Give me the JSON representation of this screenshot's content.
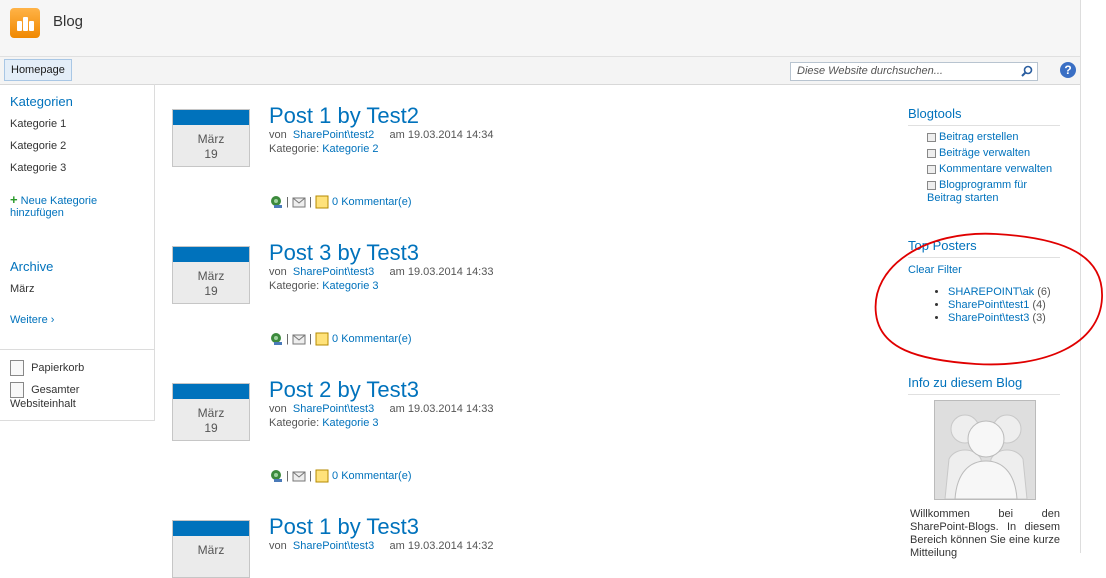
{
  "header": {
    "title": "Blog"
  },
  "topnav": {
    "home": "Homepage",
    "search_placeholder": "Diese Website durchsuchen..."
  },
  "left": {
    "categories_heading": "Kategorien",
    "categories": [
      "Kategorie 1",
      "Kategorie 2",
      "Kategorie 3"
    ],
    "new_category": "Neue Kategorie hinzufügen",
    "archive_heading": "Archive",
    "archive_items": [
      "März"
    ],
    "more": "Weitere ›",
    "recycle": "Papierkorb",
    "all_content": "Gesamter Websiteinhalt"
  },
  "posts": [
    {
      "month": "März",
      "day": "19",
      "title": "Post 1 by Test2",
      "von": "von",
      "author": "SharePoint\\test2",
      "am": "am 19.03.2014 14:34",
      "cat_label": "Kategorie:",
      "category": "Kategorie 2",
      "comments": "0 Kommentar(e)"
    },
    {
      "month": "März",
      "day": "19",
      "title": "Post 3 by Test3",
      "von": "von",
      "author": "SharePoint\\test3",
      "am": "am 19.03.2014 14:33",
      "cat_label": "Kategorie:",
      "category": "Kategorie 3",
      "comments": "0 Kommentar(e)"
    },
    {
      "month": "März",
      "day": "19",
      "title": "Post 2 by Test3",
      "von": "von",
      "author": "SharePoint\\test3",
      "am": "am 19.03.2014 14:33",
      "cat_label": "Kategorie:",
      "category": "Kategorie 3",
      "comments": "0 Kommentar(e)"
    },
    {
      "month": "März",
      "day": "",
      "title": "Post 1 by Test3",
      "von": "von",
      "author": "SharePoint\\test3",
      "am": "am 19.03.2014 14:32"
    }
  ],
  "blogtools": {
    "heading": "Blogtools",
    "items": [
      "Beitrag erstellen",
      "Beiträge verwalten",
      "Kommentare verwalten",
      "Blogprogramm für Beitrag starten"
    ]
  },
  "top_posters": {
    "heading": "Top Posters",
    "clear": "Clear Filter",
    "items": [
      {
        "name": "SHAREPOINT\\ak",
        "count": "(6)"
      },
      {
        "name": "SharePoint\\test1",
        "count": "(4)"
      },
      {
        "name": "SharePoint\\test3",
        "count": "(3)"
      }
    ]
  },
  "about": {
    "heading": "Info zu diesem Blog",
    "text": "Willkommen bei den SharePoint-Blogs. In diesem Bereich können Sie eine kurze Mitteilung"
  },
  "colors": {
    "accent": "#0072bc",
    "annotation": "#e00000"
  }
}
